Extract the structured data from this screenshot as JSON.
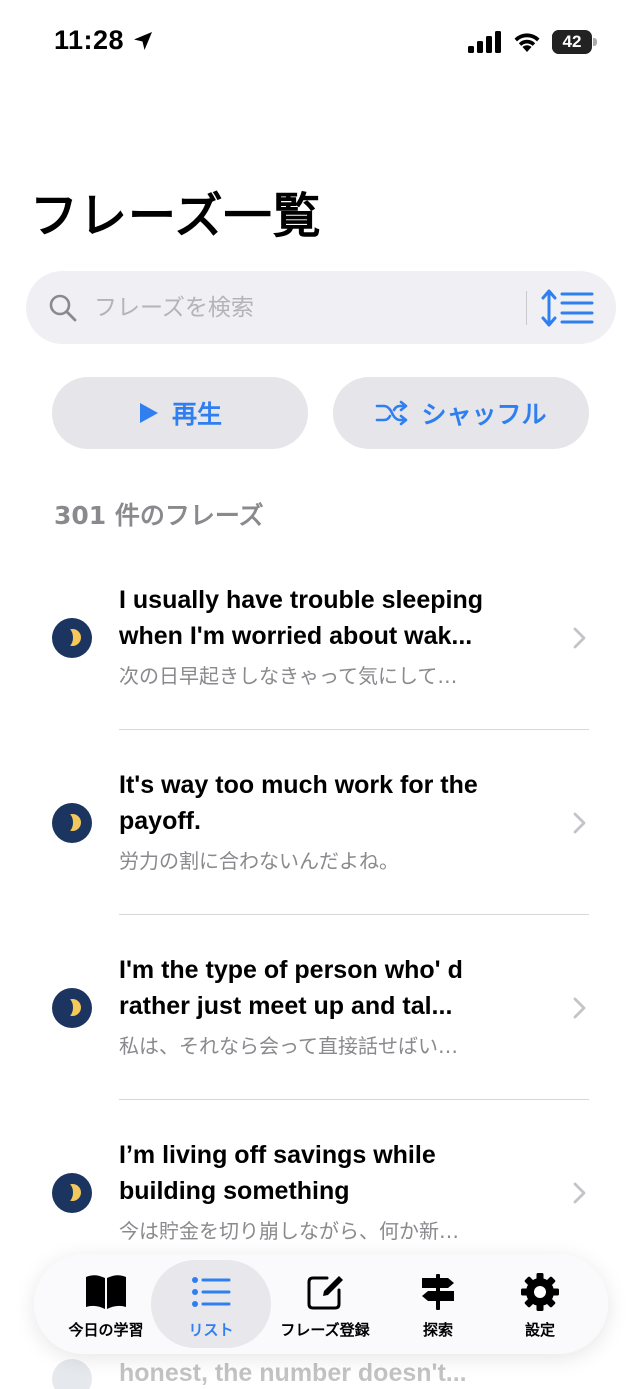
{
  "status_bar": {
    "time": "11:28",
    "battery": "42",
    "battery_level": 0.42
  },
  "header": {
    "title": "フレーズ一覧"
  },
  "search": {
    "placeholder": "フレーズを検索"
  },
  "actions": {
    "play_label": "再生",
    "shuffle_label": "シャッフル"
  },
  "list": {
    "count_label": "301 件のフレーズ",
    "items": [
      {
        "english": "I usually have trouble sleeping when I'm worried about wak...",
        "japanese": "次の日早起きしなきゃって気にして…"
      },
      {
        "english": "It's way too much work for the payoff.",
        "japanese": "労力の割に合わないんだよね。"
      },
      {
        "english": "I'm the type of person who' d rather just meet up and tal...",
        "japanese": "私は、それなら会って直接話せばい…"
      },
      {
        "english": "I’m living off savings while building something",
        "japanese": "今は貯金を切り崩しながら、何か新…"
      }
    ],
    "partial_item": "honest, the number doesn't..."
  },
  "tab_bar": {
    "tabs": [
      {
        "label": "今日の学習",
        "icon": "book-icon"
      },
      {
        "label": "リスト",
        "icon": "list-icon"
      },
      {
        "label": "フレーズ登録",
        "icon": "compose-icon"
      },
      {
        "label": "探索",
        "icon": "signpost-icon"
      },
      {
        "label": "設定",
        "icon": "gear-icon"
      }
    ],
    "active": "リスト"
  },
  "colors": {
    "accent": "#2f7ff0",
    "row_icon": "#1b3560",
    "moon": "#f4c85a"
  }
}
